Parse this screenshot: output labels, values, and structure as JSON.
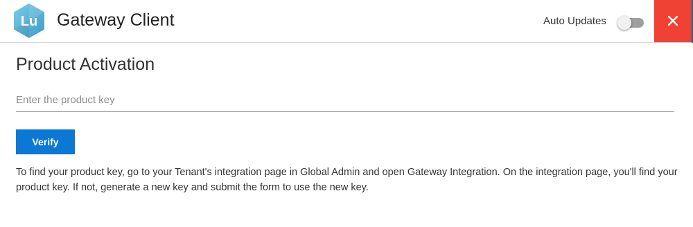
{
  "app": {
    "logo_text": "Lu",
    "title": "Gateway Client"
  },
  "header": {
    "auto_updates_label": "Auto Updates",
    "auto_updates_enabled": false
  },
  "colors": {
    "close_button": "#f04135",
    "verify_button": "#0a78d4",
    "logo_fill": "#5fb7d8"
  },
  "main": {
    "section_title": "Product Activation",
    "product_key": {
      "value": "",
      "placeholder": "Enter the product key"
    },
    "verify_label": "Verify",
    "help_text": "To find your product key, go to your Tenant's integration page in Global Admin and open Gateway Integration. On the integration page, you'll find your product key. If not, generate a new key and submit the form to use the new key."
  }
}
